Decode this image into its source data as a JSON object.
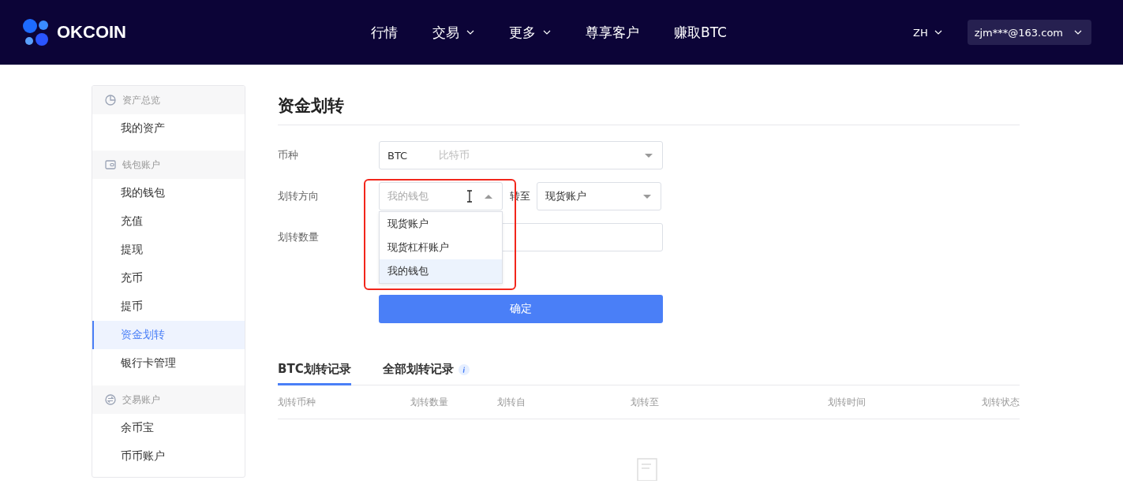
{
  "header": {
    "logo": "OKCOIN",
    "nav": [
      {
        "label": "行情",
        "dropdown": false
      },
      {
        "label": "交易",
        "dropdown": true
      },
      {
        "label": "更多",
        "dropdown": true
      },
      {
        "label": "尊享客户",
        "dropdown": false
      },
      {
        "label": "赚取BTC",
        "dropdown": false
      }
    ],
    "language": "ZH",
    "account": "zjm***@163.com"
  },
  "sidebar": {
    "groups": [
      {
        "title": "资产总览",
        "kind": "pie",
        "items": [
          {
            "label": "我的资产",
            "selected": false
          }
        ]
      },
      {
        "title": "钱包账户",
        "kind": "wallet",
        "items": [
          {
            "label": "我的钱包",
            "selected": false
          },
          {
            "label": "充值",
            "selected": false
          },
          {
            "label": "提现",
            "selected": false
          },
          {
            "label": "充币",
            "selected": false
          },
          {
            "label": "提币",
            "selected": false
          },
          {
            "label": "资金划转",
            "selected": true
          },
          {
            "label": "银行卡管理",
            "selected": false
          }
        ]
      },
      {
        "title": "交易账户",
        "kind": "exchange",
        "items": [
          {
            "label": "余币宝",
            "selected": false
          },
          {
            "label": "币币账户",
            "selected": false
          }
        ]
      }
    ]
  },
  "form": {
    "title": "资金划转",
    "currency": {
      "label": "币种",
      "code": "BTC",
      "name": "比特币"
    },
    "direction": {
      "label": "划转方向",
      "from": {
        "placeholder": "我的钱包",
        "expanded": true,
        "options": [
          {
            "label": "现货账户",
            "selected": false
          },
          {
            "label": "现货杠杆账户",
            "selected": false
          },
          {
            "label": "我的钱包",
            "selected": true
          }
        ]
      },
      "to_label": "转至",
      "to": {
        "value": "现货账户"
      }
    },
    "amount": {
      "label": "划转数量"
    },
    "submit": "确定"
  },
  "records": {
    "tabs": [
      {
        "label": "BTC划转记录",
        "selected": true,
        "info": false
      },
      {
        "label": "全部划转记录",
        "selected": false,
        "info": true
      }
    ],
    "columns": [
      "划转币种",
      "划转数量",
      "划转自",
      "划转至",
      "划转时间",
      "划转状态"
    ]
  }
}
